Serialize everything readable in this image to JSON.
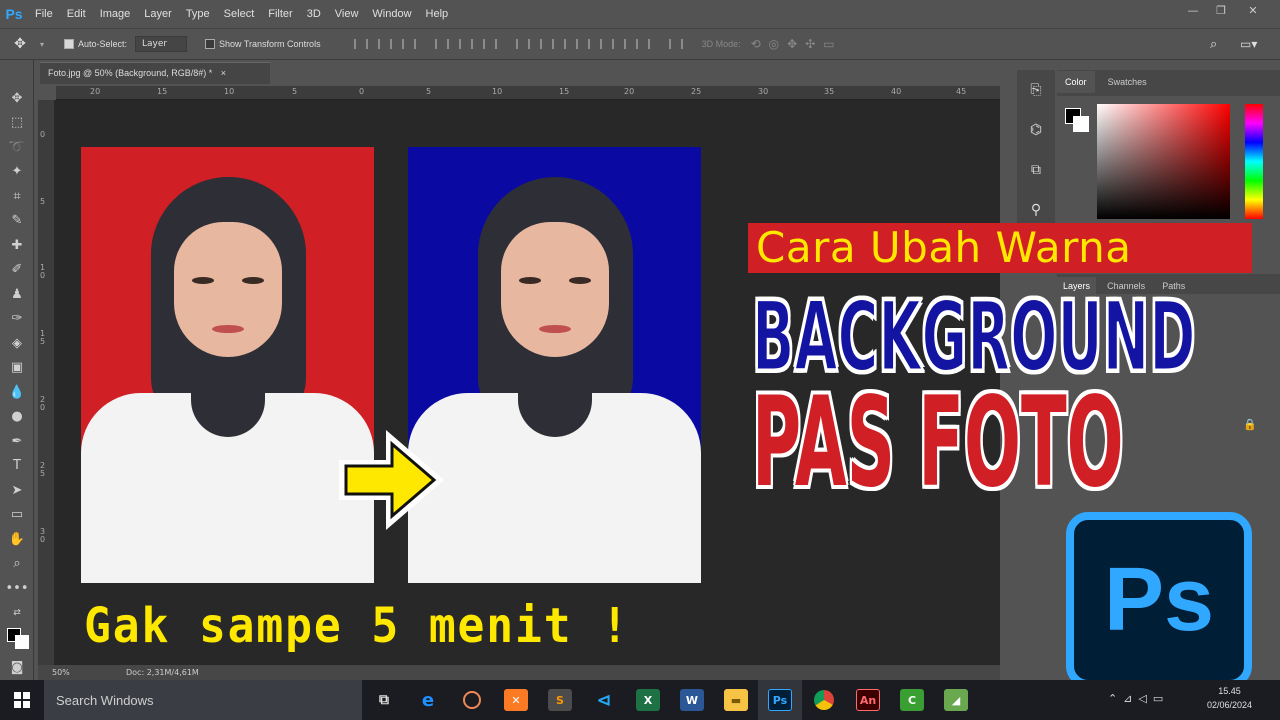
{
  "app": {
    "logo": "Ps",
    "menu": [
      "File",
      "Edit",
      "Image",
      "Layer",
      "Type",
      "Select",
      "Filter",
      "3D",
      "View",
      "Window",
      "Help"
    ],
    "window_controls": {
      "minimize": "—",
      "restore": "❐",
      "close": "✕"
    }
  },
  "options": {
    "auto_select_label": "Auto-Select:",
    "auto_select_value": "Layer",
    "show_transform_label": "Show Transform Controls",
    "mode_3d_label": "3D Mode:"
  },
  "document": {
    "tab_title": "Foto.jpg @ 50% (Background, RGB/8#) *",
    "tab_close": "×",
    "zoom": "50%",
    "doc_info": "Doc: 2,31M/4,61M",
    "ruler_top": [
      "20",
      "15",
      "10",
      "5",
      "0",
      "5",
      "10",
      "15",
      "20",
      "25",
      "30",
      "35",
      "40",
      "45"
    ],
    "ruler_left": [
      "0",
      "5",
      "1\n0",
      "1\n5",
      "2\n0",
      "2\n5",
      "3\n0"
    ]
  },
  "panels": {
    "color_tabs": [
      "Color",
      "Swatches"
    ],
    "layer_tabs": [
      "Layers",
      "Channels",
      "Paths"
    ]
  },
  "thumbnail": {
    "title_line": "Cara Ubah Warna",
    "line_background": "BACKGROUND",
    "line_pas_foto": "PAS FOTO",
    "subtitle": "Gak sampe 5 menit !",
    "logo_text": "Ps",
    "colors": {
      "red_bg": "#d01f25",
      "blue_bg": "#0a0aa3",
      "yellow": "#ffe800",
      "ps_blue": "#31a8ff",
      "ps_dark": "#001e36"
    }
  },
  "taskbar": {
    "search_placeholder": "Search Windows",
    "time": "15.45",
    "date": "02/06/2024"
  }
}
